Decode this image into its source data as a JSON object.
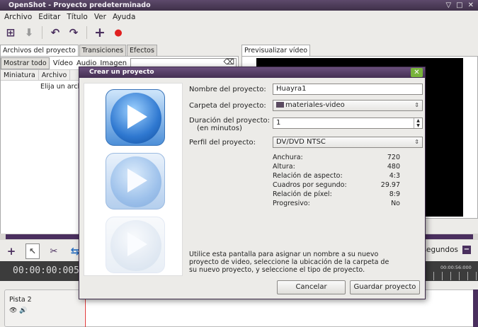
{
  "window": {
    "title": "OpenShot - Proyecto predeterminado",
    "controls": [
      "▽",
      "□",
      "✕"
    ]
  },
  "menu": [
    "Archivo",
    "Editar",
    "Título",
    "Ver",
    "Ayuda"
  ],
  "left_tabs": [
    "Archivos del proyecto",
    "Transiciones",
    "Efectos"
  ],
  "filters": {
    "show_all": "Mostrar todo",
    "video": "Vídeo",
    "audio": "Audio",
    "image": "Imagen"
  },
  "columns": [
    "Miniatura",
    "Archivo"
  ],
  "left_message": "Elija un arch",
  "preview_tab": "Previsualizar vídeo",
  "timeline": {
    "timecode": "00:00:00:005",
    "zoom_label": "segundos",
    "ruler_label": "00:00:56:000"
  },
  "track": {
    "name": "Pista 2"
  },
  "dialog": {
    "title": "Crear un proyecto",
    "close": "✕",
    "name_label": "Nombre del proyecto:",
    "name_value": "Huayra1",
    "folder_label": "Carpeta del proyecto:",
    "folder_value": "materiales-video",
    "duration_label_1": "Duración del proyecto:",
    "duration_label_2": "(en minutos)",
    "duration_value": "1",
    "profile_label": "Perfil del proyecto:",
    "profile_value": "DV/DVD NTSC",
    "info": [
      {
        "k": "Anchura:",
        "v": "720"
      },
      {
        "k": "Altura:",
        "v": "480"
      },
      {
        "k": "Relación de aspecto:",
        "v": "4:3"
      },
      {
        "k": "Cuadros por segundo:",
        "v": "29.97"
      },
      {
        "k": "Relación de píxel:",
        "v": "8:9"
      },
      {
        "k": "Progresivo:",
        "v": "No"
      }
    ],
    "description_1": "Utilice esta pantalla para asignar un nombre a su nuevo",
    "description_2": "proyecto de video, seleccione la ubicación de la carpeta de",
    "description_3": "su nuevo proyecto, y seleccione el tipo de proyecto.",
    "cancel": "Cancelar",
    "save": "Guardar proyecto"
  }
}
